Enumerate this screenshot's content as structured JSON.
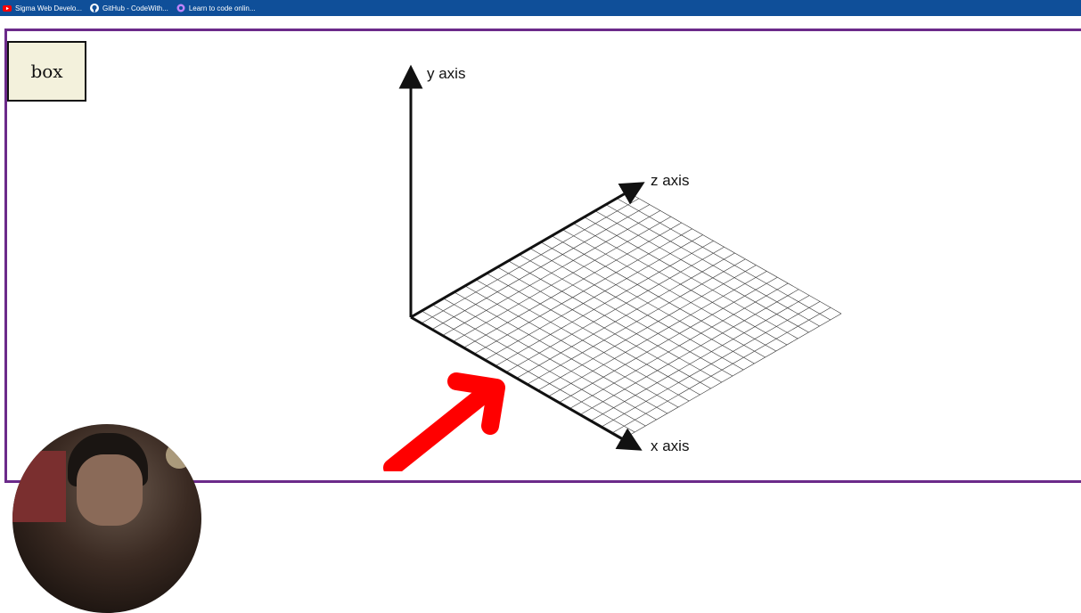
{
  "bookmarks": [
    {
      "label": "Sigma Web Develo...",
      "icon": "youtube-icon",
      "color": "#ff0000"
    },
    {
      "label": "GitHub - CodeWith...",
      "icon": "github-icon",
      "color": "#ffffff"
    },
    {
      "label": "Learn to code onlin...",
      "icon": "freecodecamp-icon",
      "color": "#c084fc"
    }
  ],
  "box": {
    "label": "box"
  },
  "axes": {
    "y_label": "y axis",
    "z_label": "z axis",
    "x_label": "x axis"
  },
  "grid": {
    "rows": 20,
    "cols": 20
  },
  "colors": {
    "bookmarks_bar": "#0f4f99",
    "frame_border": "#6b2a8a",
    "box_fill": "#f3f1dc",
    "arrow": "#ff0000"
  }
}
